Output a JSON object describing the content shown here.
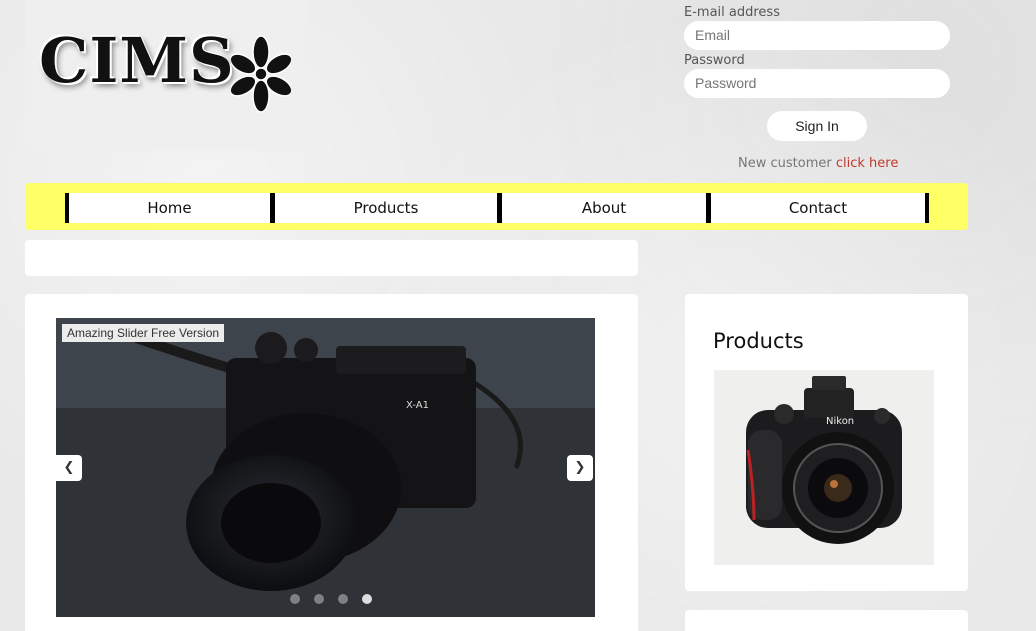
{
  "logo": {
    "text": "CIMS"
  },
  "login": {
    "email_label": "E-mail address",
    "email_placeholder": "Email",
    "password_label": "Password",
    "password_placeholder": "Password",
    "signin_label": "Sign In",
    "new_customer_text": "New customer",
    "click_here": "click here"
  },
  "nav": {
    "items": [
      {
        "label": "Home"
      },
      {
        "label": "Products"
      },
      {
        "label": "About"
      },
      {
        "label": "Contact"
      }
    ]
  },
  "slider": {
    "badge": "Amazing Slider Free Version",
    "slide_count": 4,
    "active_slide": 4
  },
  "sidebar": {
    "title": "Products"
  },
  "colors": {
    "nav_bg": "#ffff66",
    "link": "#c0392b"
  }
}
